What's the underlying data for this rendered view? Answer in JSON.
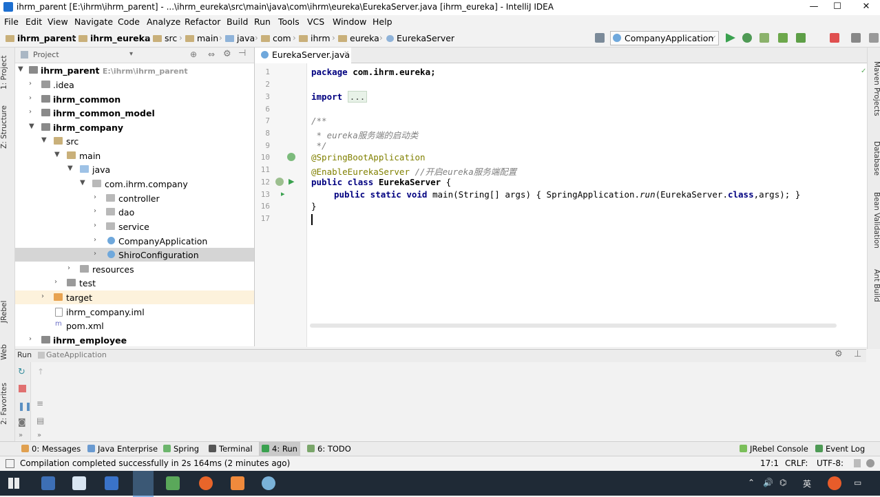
{
  "window": {
    "title": "ihrm_parent [E:\\ihrm\\ihrm_parent] - ...\\ihrm_eureka\\src\\main\\java\\com\\ihrm\\eureka\\EurekaServer.java [ihrm_eureka] - IntelliJ IDEA",
    "minimize": "—",
    "maximize": "☐",
    "close": "✕"
  },
  "menu": [
    "File",
    "Edit",
    "View",
    "Navigate",
    "Code",
    "Analyze",
    "Refactor",
    "Build",
    "Run",
    "Tools",
    "VCS",
    "Window",
    "Help"
  ],
  "navbar": {
    "crumbs": [
      "ihrm_parent",
      "ihrm_eureka",
      "src",
      "main",
      "java",
      "com",
      "ihrm",
      "eureka",
      "EurekaServer"
    ],
    "run_config": "CompanyApplication"
  },
  "left_tabs": [
    "1: Project",
    "Z: Structure",
    "JRebel",
    "Web",
    "2: Favorites"
  ],
  "right_tabs": [
    "Maven Projects",
    "Database",
    "Bean Validation",
    "Ant Build"
  ],
  "project": {
    "header": "Project",
    "tree": [
      {
        "name": "ihrm_parent",
        "sub": "E:\\ihrm\\ihrm_parent"
      },
      {
        "name": ".idea"
      },
      {
        "name": "ihrm_common"
      },
      {
        "name": "ihrm_common_model"
      },
      {
        "name": "ihrm_company"
      },
      {
        "name": "src"
      },
      {
        "name": "main"
      },
      {
        "name": "java"
      },
      {
        "name": "com.ihrm.company"
      },
      {
        "name": "controller"
      },
      {
        "name": "dao"
      },
      {
        "name": "service"
      },
      {
        "name": "CompanyApplication"
      },
      {
        "name": "ShiroConfiguration"
      },
      {
        "name": "resources"
      },
      {
        "name": "test"
      },
      {
        "name": "target"
      },
      {
        "name": "ihrm_company.iml"
      },
      {
        "name": "pom.xml"
      },
      {
        "name": "ihrm_employee"
      }
    ]
  },
  "editor": {
    "tab": "EurekaServer.java",
    "line_numbers": [
      "1",
      "2",
      "3",
      "6",
      "7",
      "8",
      "9",
      "10",
      "11",
      "12",
      "13",
      "16",
      "17"
    ],
    "code": {
      "l1_kw": "package",
      "l1_rest": " com.ihrm.eureka;",
      "l3_kw": "import",
      "l3_fold": "...",
      "l7": "/**",
      "l8": " * eureka服务端的启动类",
      "l9": " */",
      "l10": "@SpringBootApplication",
      "l11_an": "@EnableEurekaServer",
      "l11_cm": " //开启eureka服务端配置",
      "l12_kw": "public class",
      "l12_name": " EurekaServer",
      "l12_rest": " {",
      "l13_kw": "public static void",
      "l13_a": " main(String[] args) { SpringApplication.",
      "l13_run": "run",
      "l13_b": "(EurekaServer.",
      "l13_class": "class",
      "l13_c": ",args); }",
      "l16": "}"
    }
  },
  "run_panel": {
    "label": "Run",
    "config": "GateApplication"
  },
  "tool_tabs": {
    "left": [
      "0: Messages",
      "Java Enterprise",
      "Spring",
      "Terminal",
      "4: Run",
      "6: TODO"
    ],
    "right": [
      "JRebel Console",
      "Event Log"
    ]
  },
  "status": {
    "message": "Compilation completed successfully in 2s 164ms (2 minutes ago)",
    "position": "17:1",
    "line_sep": "CRLF:",
    "encoding": "UTF-8:"
  },
  "taskbar": {
    "ime": "英",
    "speaker": "🔊"
  }
}
